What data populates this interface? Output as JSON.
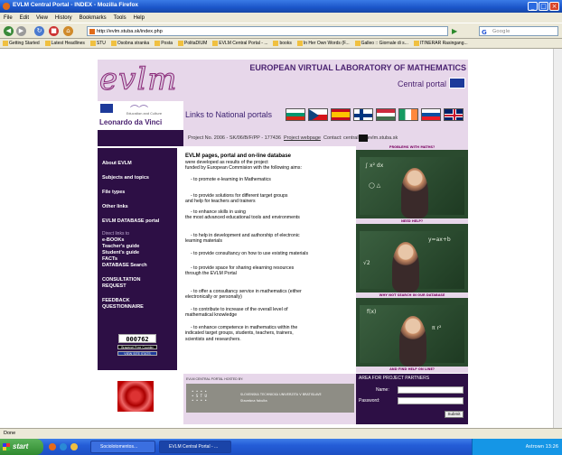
{
  "window": {
    "title": "EVLM Central Portal - INDEX - Mozilla Firefox"
  },
  "menu": [
    "File",
    "Edit",
    "View",
    "History",
    "Bookmarks",
    "Tools",
    "Help"
  ],
  "nav": {
    "url": "http://evlm.stuba.sk/index.php",
    "search_placeholder": "Google"
  },
  "bookmarks": [
    "Getting Started",
    "Latest Headlines",
    "STU",
    "Osobna stranka",
    "Posta",
    "PolitaDIUM",
    "EVLM Central Portal - ...",
    "books",
    "In Her Own Words (F...",
    "Galleo :: Giornale di s...",
    "ITINERAR Rasingang..."
  ],
  "page": {
    "logo": "evlm",
    "site_title": "EUROPEAN VIRTUAL LABORATORY OF MATHEMATICS",
    "portal_label": "Central portal",
    "leonardo": "Leonardo da Vinci",
    "leo_tiny": "Education and Culture",
    "links_label": "Links to National portals",
    "project": {
      "text": "Project No. 2006 - SK/06/B/F/PP - 177436",
      "webpage_link": "Project webpage",
      "contact": "Contact: central",
      "email_suffix": "evlm.stuba.sk"
    },
    "sidebar": {
      "main_items": [
        "About EVLM",
        "Subjects and topics",
        "File types",
        "Other links",
        "EVLM DATABASE portal"
      ],
      "direct_label": "Direct links to",
      "direct_items": [
        "e-BOOKs",
        "Teacher's guide",
        "Student's guide",
        "FACTs",
        "DATABASE Search"
      ],
      "consult": [
        "CONSULTATION",
        "REQUEST"
      ],
      "feedback": [
        "FEEDBACK",
        "QUESTIONNAIRE"
      ],
      "counter": "000762",
      "counter_btn1": "Bravenet Free Counter",
      "counter_btn2": "VIEW SITE STATS"
    },
    "main": {
      "heading": "EVLM pages, portal and on-line database",
      "intro": [
        "were developed as results of the project",
        "funded by European Commision with the following aims:"
      ],
      "aims": [
        [
          "- to promote e-learning in Mathematics"
        ],
        [
          "- to provide solutions for different target groups",
          "and help for teachers and trainers"
        ],
        [
          "- to enhance skills in using",
          "the most advanced educational tools and environments"
        ],
        [
          "- to help in development and authorship of electronic",
          "learning materials"
        ],
        [
          "- to provide consultancy on how to use existing materials"
        ],
        [
          "- to provide space for sharing elearning resources",
          "through the EVLM Portal"
        ],
        [
          "- to offer a consultancy service in mathematics (either",
          "electronically or personally)"
        ],
        [
          "- to contribute to increase of the overall level of",
          "mathematical knowledge"
        ],
        [
          "- to enhance competence in mathematics within the",
          "indicated target groups, students, teachers, trainers,",
          "scientists and researchers."
        ]
      ]
    },
    "photos": {
      "captions": [
        "PROBLEMS WITH MATHS?",
        "NEED HELP?",
        "WHY NOT SEARCH IN OUR DATABASE",
        "AND FIND HELP ON LINE?"
      ]
    },
    "footer": {
      "hosted_title": "EVLM CENTRAL PORTAL HOSTED BY:",
      "stu_name": "SLOVENSKA TECHNICKA UNIVERZITA V BRATISLAVE",
      "stu_sub": "Stavebna fakulta",
      "login_title": "AREA FOR PROJECT PARTNERS",
      "name_label": "Name:",
      "password_label": "Password:",
      "submit": "Submit"
    }
  },
  "status": "Done",
  "taskbar": {
    "start": "start",
    "tasks": [
      "Sociolotomentos...",
      "EVLM Central Portal - ..."
    ],
    "tray_text": "Astrown 13:26"
  },
  "colors": {
    "dark_purple": "#2d0f45",
    "light_purple": "#e7d7ea",
    "title_purple": "#4b2371"
  }
}
